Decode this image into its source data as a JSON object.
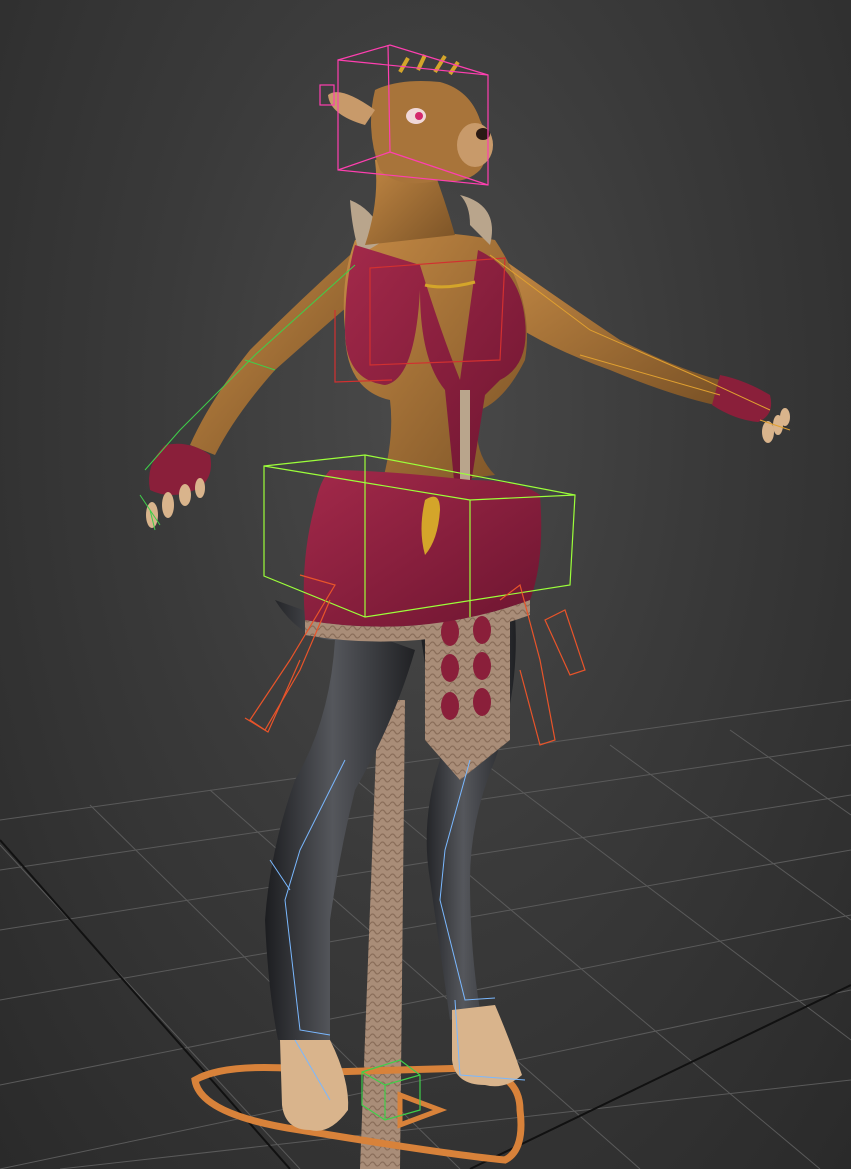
{
  "viewport": {
    "mode": "perspective",
    "background_color": "#3a3a3a",
    "grid_visible": true,
    "grid_color": "#5c5c5c"
  },
  "scene": {
    "model": "deer-character-mesh",
    "rig_visible": true,
    "colors": {
      "skin": "#a8743a",
      "outfit": "#8a1f3a",
      "trim": "#b9a58c",
      "legs": "#2e2f33",
      "hooves": "#d9b48c",
      "gold": "#d4a52a"
    },
    "rig_colors": {
      "head": "#ff3fb0",
      "spine": "#d23030",
      "pelvis": "#9cff3a",
      "left_arm": "#3fcf4a",
      "right_arm": "#e0a030",
      "thigh_left": "#e8542a",
      "thigh_right": "#e8542a",
      "shin": "#7ab8ff",
      "root": "#d8823a"
    }
  }
}
